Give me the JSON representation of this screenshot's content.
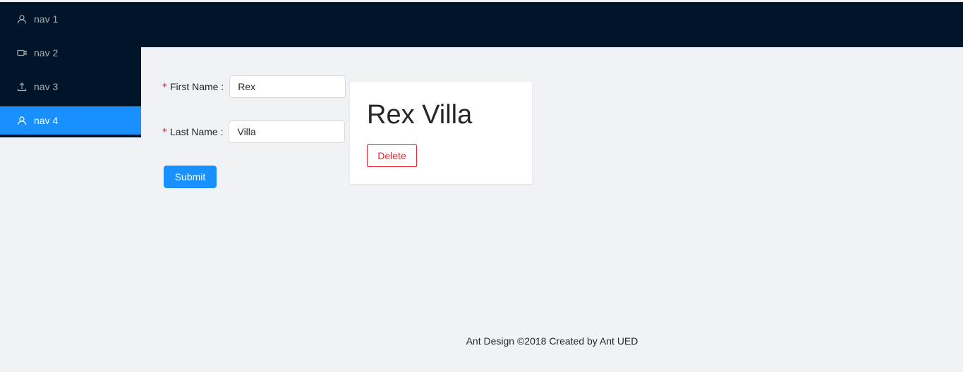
{
  "sidebar": {
    "items": [
      {
        "label": "nav 1",
        "icon": "user-icon",
        "selected": false
      },
      {
        "label": "nav 2",
        "icon": "video-camera-icon",
        "selected": false
      },
      {
        "label": "nav 3",
        "icon": "upload-icon",
        "selected": false
      },
      {
        "label": "nav 4",
        "icon": "user-icon",
        "selected": true
      }
    ]
  },
  "form": {
    "first_name": {
      "label": "First Name",
      "value": "Rex",
      "required": true
    },
    "last_name": {
      "label": "Last Name",
      "value": "Villa",
      "required": true
    },
    "submit_label": "Submit"
  },
  "card": {
    "title": "Rex Villa",
    "delete_label": "Delete"
  },
  "footer": {
    "text": "Ant Design ©2018 Created by Ant UED"
  },
  "colors": {
    "header_bg": "#001529",
    "primary": "#1890ff",
    "danger": "#f5222d",
    "content_bg": "#f0f2f5"
  }
}
